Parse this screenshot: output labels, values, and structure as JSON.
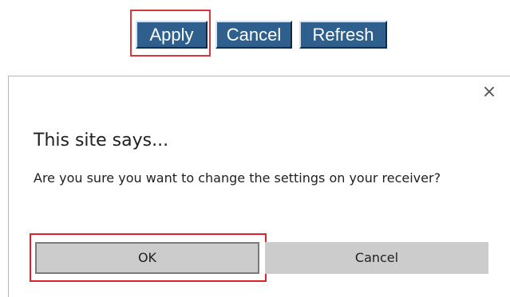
{
  "toolbar": {
    "apply_label": "Apply",
    "cancel_label": "Cancel",
    "refresh_label": "Refresh"
  },
  "dialog": {
    "close_glyph": "×",
    "title": "This site says...",
    "message": "Are you sure you want to change the settings on your receiver?",
    "ok_label": "OK",
    "cancel_label": "Cancel"
  },
  "colors": {
    "toolbar_button_bg": "#2e5f8d",
    "highlight_border": "#e0202a",
    "dialog_button_bg": "#cccccc"
  },
  "icons": {
    "close": "close-icon"
  }
}
